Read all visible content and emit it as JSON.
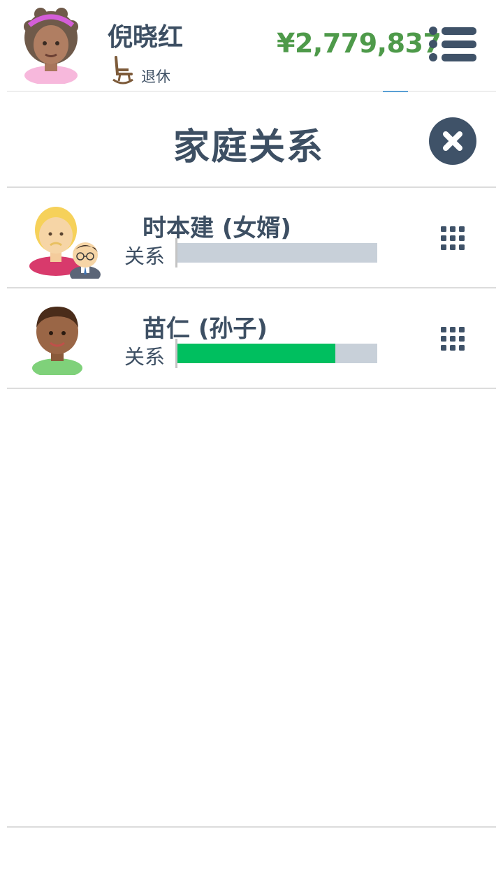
{
  "header": {
    "player_name": "倪晓红",
    "status_icon": "rocking-chair-icon",
    "status_label": "退休",
    "money": "¥2,779,837",
    "menu_icon": "list-menu-icon"
  },
  "page": {
    "title": "家庭关系",
    "close_icon": "close-icon"
  },
  "relations": [
    {
      "name": "时本建 (女婿)",
      "label": "关系",
      "value": 0.0,
      "avatar": "blonde-person-with-glasses-man-avatar",
      "action_icon": "grid-dots-icon"
    },
    {
      "name": "苗仁 (孙子)",
      "label": "关系",
      "value": 0.79,
      "avatar": "boy-avatar",
      "action_icon": "grid-dots-icon"
    }
  ],
  "colors": {
    "text": "#3d4f63",
    "money": "#4e9a4a",
    "bar_fill": "#00bf5f",
    "bar_track": "#c8d0d9",
    "button": "#3f5268"
  }
}
